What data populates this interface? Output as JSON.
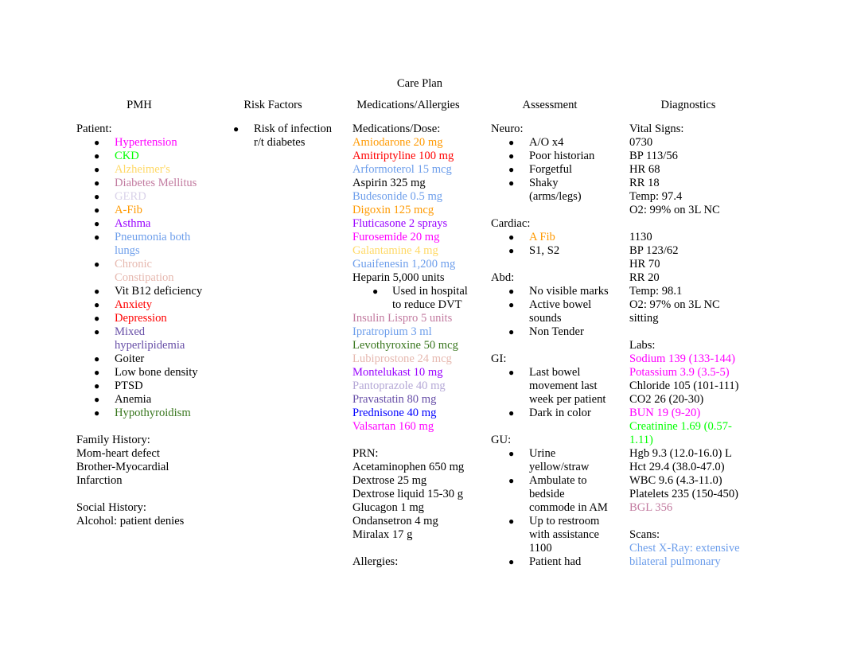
{
  "title": "Care Plan",
  "colors": {
    "magenta": "#ff00ff",
    "green": "#00ff00",
    "light_yellow": "#ffd966",
    "mauve": "#c27ba0",
    "lavender": "#d9d2e9",
    "orange": "#ff9900",
    "purple": "#9900ff",
    "cornflower": "#6d9eeb",
    "pink_light": "#e6b8af",
    "red": "#ff0000",
    "slate_purple": "#674ea7",
    "dark_green": "#38761d",
    "light_purple": "#b4a7d6",
    "blue": "#0000ff",
    "black": "#000000"
  },
  "pmh": {
    "header": "PMH",
    "patient_label": "Patient:",
    "items": [
      {
        "text": "Hypertension",
        "color": "#ff00ff"
      },
      {
        "text": "CKD",
        "color": "#00ff00"
      },
      {
        "text": "Alzheimer's",
        "color": "#ffd966"
      },
      {
        "text": "Diabetes Mellitus",
        "color": "#c27ba0"
      },
      {
        "text": "GERD",
        "color": "#d9d2e9"
      },
      {
        "text": "A-Fib",
        "color": "#ff9900"
      },
      {
        "text": "Asthma",
        "color": "#9900ff"
      },
      {
        "text": "Pneumonia both lungs",
        "color": "#6d9eeb"
      },
      {
        "text": "Chronic Constipation",
        "color": "#e6b8af"
      },
      {
        "text": "Vit B12 deficiency",
        "color": "#000000"
      },
      {
        "text": "Anxiety",
        "color": "#ff0000"
      },
      {
        "text": "Depression",
        "color": "#ff0000"
      },
      {
        "text": "Mixed hyperlipidemia",
        "color": "#674ea7"
      },
      {
        "text": "Goiter",
        "color": "#000000"
      },
      {
        "text": "Low bone density",
        "color": "#000000"
      },
      {
        "text": "PTSD",
        "color": "#000000"
      },
      {
        "text": "Anemia",
        "color": "#000000"
      },
      {
        "text": "Hypothyroidism",
        "color": "#38761d"
      }
    ],
    "family_history_label": "Family History:",
    "family_history": [
      "Mom-heart defect",
      "Brother-Myocardial Infarction"
    ],
    "social_history_label": "Social History:",
    "social_history": [
      "Alcohol: patient denies"
    ]
  },
  "risk": {
    "header": "Risk Factors",
    "items": [
      "Risk of infection r/t diabetes"
    ]
  },
  "meds": {
    "header": "Medications/Allergies",
    "dose_label": "Medications/Dose:",
    "items": [
      {
        "text": "Amiodarone 20 mg",
        "color": "#ff9900"
      },
      {
        "text": "Amitriptyline 100 mg",
        "color": "#ff0000"
      },
      {
        "text": "Arformoterol 15 mcg",
        "color": "#6d9eeb"
      },
      {
        "text": "Aspirin 325 mg",
        "color": "#000000"
      },
      {
        "text": "Budesonide 0.5 mg",
        "color": "#6d9eeb"
      },
      {
        "text": "Digoxin 125 mcg",
        "color": "#ff9900"
      },
      {
        "text": "Fluticasone 2 sprays",
        "color": "#9900ff"
      },
      {
        "text": "Furosemide 20 mg",
        "color": "#ff00ff"
      },
      {
        "text": "Galantamine 4 mg",
        "color": "#ffd966"
      },
      {
        "text": "Guaifenesin 1,200 mg",
        "color": "#6d9eeb"
      },
      {
        "text": "Heparin 5,000 units",
        "color": "#000000"
      }
    ],
    "heparin_note": "Used in hospital to reduce DVT",
    "items2": [
      {
        "text": "Insulin Lispro 5 units",
        "color": "#c27ba0"
      },
      {
        "text": "Ipratropium 3 ml",
        "color": "#6d9eeb"
      },
      {
        "text": "Levothyroxine 50 mcg",
        "color": "#38761d"
      },
      {
        "text": "Lubiprostone 24 mcg",
        "color": "#e6b8af"
      },
      {
        "text": "Montelukast 10 mg",
        "color": "#9900ff"
      },
      {
        "text": "Pantoprazole 40 mg",
        "color": "#b4a7d6"
      },
      {
        "text": "Pravastatin 80 mg",
        "color": "#674ea7"
      },
      {
        "text": "Prednisone 40 mg",
        "color": "#0000ff"
      },
      {
        "text": "Valsartan 160 mg",
        "color": "#ff00ff"
      }
    ],
    "prn_label": "PRN:",
    "prn": [
      "Acetaminophen 650 mg",
      "Dextrose 25 mg",
      "Dextrose liquid 15-30 g",
      "Glucagon 1 mg",
      "Ondansetron 4 mg",
      "Miralax 17 g"
    ],
    "allergies_label": "Allergies:"
  },
  "assessment": {
    "header": "Assessment",
    "sections": [
      {
        "label": "Neuro:",
        "items": [
          {
            "text": "A/O x4",
            "color": "#000000"
          },
          {
            "text": "Poor historian",
            "color": "#000000"
          },
          {
            "text": "Forgetful",
            "color": "#000000"
          },
          {
            "text": "Shaky (arms/legs)",
            "color": "#000000"
          }
        ]
      },
      {
        "label": "Cardiac:",
        "items": [
          {
            "text": "A Fib",
            "color": "#ff9900"
          },
          {
            "text": "S1, S2",
            "color": "#000000"
          }
        ]
      },
      {
        "label": "Abd:",
        "items": [
          {
            "text": "No visible marks",
            "color": "#000000"
          },
          {
            "text": "Active bowel sounds",
            "color": "#000000"
          },
          {
            "text": "Non Tender",
            "color": "#000000"
          }
        ]
      },
      {
        "label": "GI:",
        "items": [
          {
            "text": "Last bowel movement last week per patient",
            "color": "#000000"
          },
          {
            "text": "Dark in color",
            "color": "#000000"
          }
        ]
      },
      {
        "label": "GU:",
        "items": [
          {
            "text": "Urine yellow/straw",
            "color": "#000000"
          },
          {
            "text": "Ambulate to bedside commode in AM",
            "color": "#000000"
          },
          {
            "text": "Up to restroom with assistance 1100",
            "color": "#000000"
          },
          {
            "text": "Patient had",
            "color": "#000000"
          }
        ]
      }
    ]
  },
  "diagnostics": {
    "header": "Diagnostics",
    "vitals_label": "Vital Signs:",
    "vitals_0730": [
      "0730",
      "BP 113/56",
      "HR 68",
      "RR 18",
      "Temp: 97.4",
      "O2: 99% on 3L NC"
    ],
    "vitals_1130": [
      "1130",
      "BP 123/62",
      "HR 70",
      "RR 20",
      "Temp: 98.1",
      "O2: 97% on 3L NC sitting"
    ],
    "labs_label": "Labs:",
    "labs": [
      {
        "text": "Sodium 139 (133-144)",
        "color": "#ff00ff"
      },
      {
        "text": "Potassium 3.9 (3.5-5)",
        "color": "#ff00ff"
      },
      {
        "text": "Chloride 105 (101-111)",
        "color": "#000000"
      },
      {
        "text": "CO2 26 (20-30)",
        "color": "#000000"
      },
      {
        "text": "BUN 19 (9-20)",
        "color": "#ff00ff"
      },
      {
        "text": "Creatinine 1.69 (0.57-1.11)",
        "color": "#00ff00"
      },
      {
        "text": "Hgb 9.3 (12.0-16.0) L",
        "color": "#000000"
      },
      {
        "text": "Hct 29.4 (38.0-47.0)",
        "color": "#000000"
      },
      {
        "text": "WBC 9.6 (4.3-11.0)",
        "color": "#000000"
      },
      {
        "text": "Platelets 235 (150-450)",
        "color": "#000000"
      },
      {
        "text": "BGL 356",
        "color": "#c27ba0"
      }
    ],
    "scans_label": "Scans:",
    "scans": [
      {
        "text": "Chest X-Ray: extensive bilateral pulmonary",
        "color": "#6d9eeb"
      }
    ]
  }
}
